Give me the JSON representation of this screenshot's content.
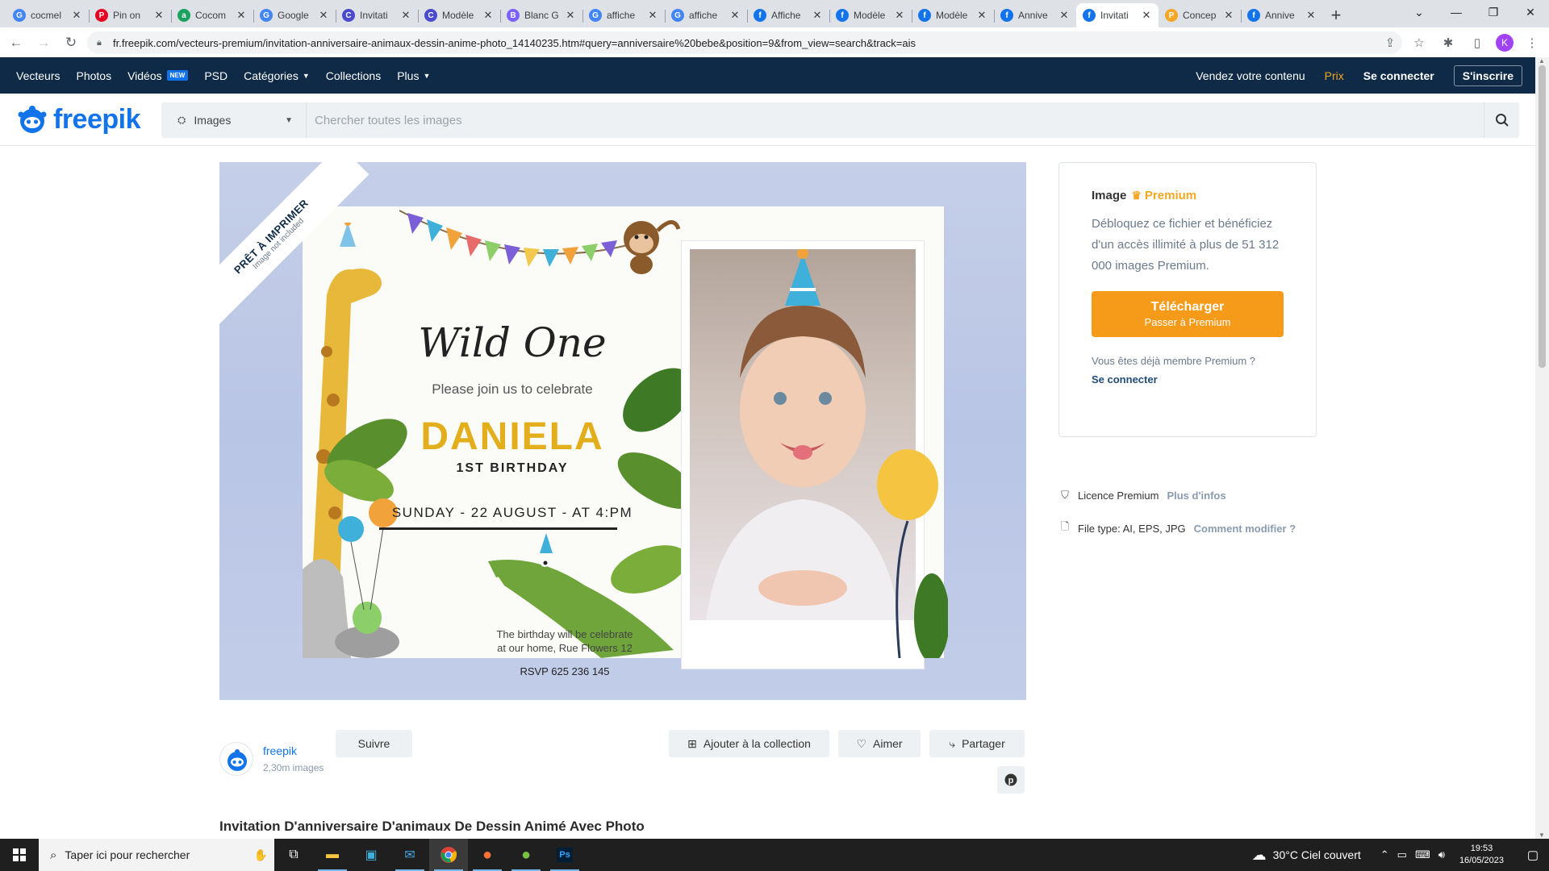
{
  "browser": {
    "tabs": [
      {
        "title": "cocmel",
        "icon": "google-icon",
        "color": "#4285f4",
        "glyph": "G"
      },
      {
        "title": "Pin on",
        "icon": "pinterest-icon",
        "color": "#e60023",
        "glyph": "P"
      },
      {
        "title": "Cocom",
        "icon": "amazon-icon",
        "color": "#1aa260",
        "glyph": "a"
      },
      {
        "title": "Google",
        "icon": "google-lens-icon",
        "color": "#4285f4",
        "glyph": "G"
      },
      {
        "title": "Invitati",
        "icon": "canva-icon",
        "color": "#4b4acf",
        "glyph": "C"
      },
      {
        "title": "Modèle",
        "icon": "canva-icon",
        "color": "#4b4acf",
        "glyph": "C"
      },
      {
        "title": "Blanc G",
        "icon": "doc-icon",
        "color": "#7b61ff",
        "glyph": "B"
      },
      {
        "title": "affiche",
        "icon": "google-icon",
        "color": "#4285f4",
        "glyph": "G"
      },
      {
        "title": "affiche",
        "icon": "google-icon",
        "color": "#4285f4",
        "glyph": "G"
      },
      {
        "title": "Affiche",
        "icon": "freepik-icon",
        "color": "#1273eb",
        "glyph": "f"
      },
      {
        "title": "Modèle",
        "icon": "freepik-icon",
        "color": "#1273eb",
        "glyph": "f"
      },
      {
        "title": "Modèle",
        "icon": "freepik-icon",
        "color": "#1273eb",
        "glyph": "f"
      },
      {
        "title": "Annive",
        "icon": "freepik-icon",
        "color": "#1273eb",
        "glyph": "f"
      },
      {
        "title": "Invitati",
        "icon": "freepik-icon",
        "color": "#1273eb",
        "glyph": "f",
        "active": true
      },
      {
        "title": "Concep",
        "icon": "p-icon",
        "color": "#f5a623",
        "glyph": "P"
      },
      {
        "title": "Annive",
        "icon": "freepik-icon",
        "color": "#1273eb",
        "glyph": "f"
      }
    ],
    "url": "fr.freepik.com/vecteurs-premium/invitation-anniversaire-animaux-dessin-anime-photo_14140235.htm#query=anniversaire%20bebe&position=9&from_view=search&track=ais",
    "profile_initial": "K"
  },
  "nav": {
    "items": [
      "Vecteurs",
      "Photos",
      "Vidéos",
      "PSD",
      "Catégories",
      "Collections",
      "Plus"
    ],
    "new_badge": "NEW",
    "sell": "Vendez votre contenu",
    "price": "Prix",
    "login": "Se connecter",
    "signup": "S'inscrire"
  },
  "header": {
    "logo": "freepik",
    "search_type": "Images",
    "search_placeholder": "Chercher toutes les images"
  },
  "hero": {
    "ribbon_main": "PRÊT À IMPRIMER",
    "ribbon_sub": "Image not included",
    "invite_title": "Wild One",
    "invite_sub": "Please join us to celebrate",
    "name": "DANIELA",
    "birthday": "1ST BIRTHDAY",
    "date": "SUNDAY - 22 AUGUST - AT 4:PM",
    "place_line1": "The birthday will be celebrate",
    "place_line2": "at our home, Rue Flowers 12",
    "rsvp": "RSVP 625 236 145"
  },
  "premium": {
    "label": "Image",
    "badge": "Premium",
    "description": "Débloquez ce fichier et bénéficiez d'un accès illimité à plus de 51 312 000 images Premium.",
    "download_main": "Télécharger",
    "download_sub": "Passer à Premium",
    "already": "Vous êtes déjà membre Premium ?",
    "connect": "Se connecter"
  },
  "meta": {
    "license": "Licence Premium",
    "license_link": "Plus d'infos",
    "filetype": "File type: AI, EPS, JPG",
    "filetype_link": "Comment modifier ?"
  },
  "author": {
    "name": "freepik",
    "count": "2,30m images",
    "follow": "Suivre"
  },
  "actions": {
    "collection": "Ajouter à la collection",
    "like": "Aimer",
    "share": "Partager"
  },
  "page_title": "Invitation D'anniversaire D'animaux De Dessin Animé Avec Photo",
  "taskbar": {
    "search": "Taper ici pour rechercher",
    "weather": "30°C  Ciel couvert",
    "time": "19:53",
    "date": "16/05/2023"
  }
}
